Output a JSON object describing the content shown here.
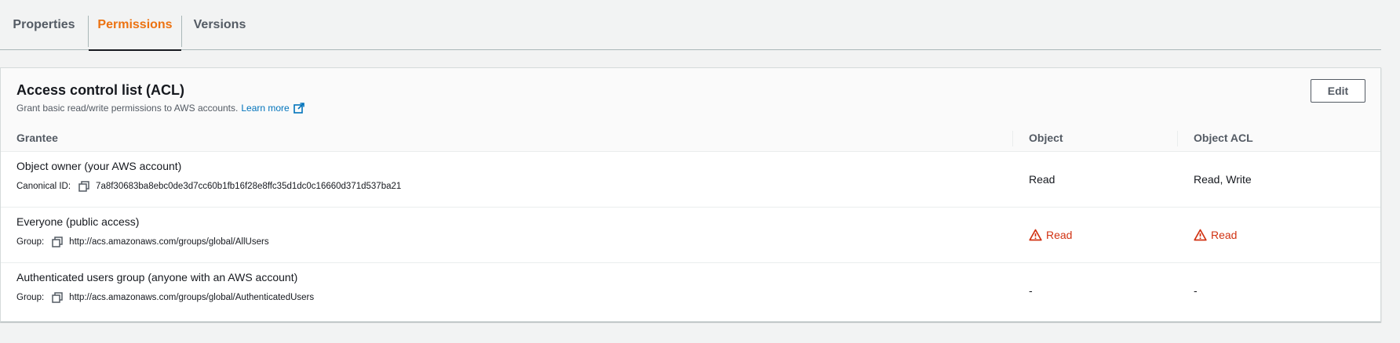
{
  "tabs": [
    {
      "label": "Properties"
    },
    {
      "label": "Permissions"
    },
    {
      "label": "Versions"
    }
  ],
  "panel": {
    "title": "Access control list (ACL)",
    "description": "Grant basic read/write permissions to AWS accounts.",
    "learn_more": "Learn more",
    "edit_label": "Edit"
  },
  "table": {
    "headers": {
      "grantee": "Grantee",
      "object": "Object",
      "object_acl": "Object ACL"
    },
    "rows": [
      {
        "grantee": "Object owner (your AWS account)",
        "id_label": "Canonical ID:",
        "id_value": "7a8f30683ba8ebc0de3d7cc60b1fb16f28e8ffc35d1dc0c16660d371d537ba21",
        "object": "Read",
        "object_acl": "Read, Write"
      },
      {
        "grantee": "Everyone (public access)",
        "id_label": "Group:",
        "id_value": "http://acs.amazonaws.com/groups/global/AllUsers",
        "object": "Read",
        "object_acl": "Read"
      },
      {
        "grantee": "Authenticated users group (anyone with an AWS account)",
        "id_label": "Group:",
        "id_value": "http://acs.amazonaws.com/groups/global/AuthenticatedUsers",
        "object": "-",
        "object_acl": "-"
      }
    ]
  },
  "colors": {
    "active_tab": "#ec7211",
    "link": "#0073bb",
    "warning": "#d13212"
  }
}
